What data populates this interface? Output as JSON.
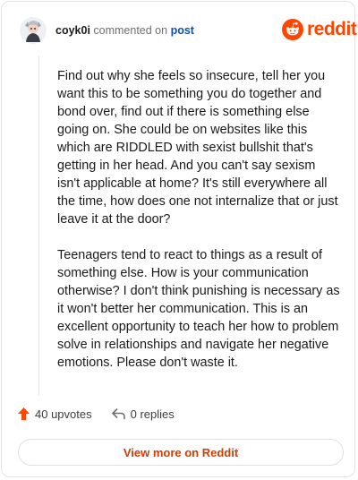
{
  "header": {
    "username": "coyk0i",
    "commented_text": "commented on",
    "post_link": "post",
    "brand": "reddit"
  },
  "comment": {
    "paragraphs": [
      "Find out why she feels so insecure, tell her you want this to be something you do together and bond over, find out if there is something else going on. She could be on websites like this which are RIDDLED with sexist bullshit that's getting in her head. And you can't say sexism isn't applicable at home? It's still everywhere all the time, how does one not internalize that or just leave it at the door?",
      "Teenagers tend to react to things as a result of something else. How is your communication otherwise? I don't think punishing is necessary as it won't better her communication. This is an excellent opportunity to teach her how to problem solve in relationships and navigate her negative emotions. Please don't waste it."
    ]
  },
  "actions": {
    "upvotes": "40 upvotes",
    "replies": "0 replies"
  },
  "footer": {
    "view_more": "View more on Reddit"
  },
  "colors": {
    "brand": "#ff4500",
    "link": "#0b52a8",
    "view_more": "#d93a00"
  }
}
